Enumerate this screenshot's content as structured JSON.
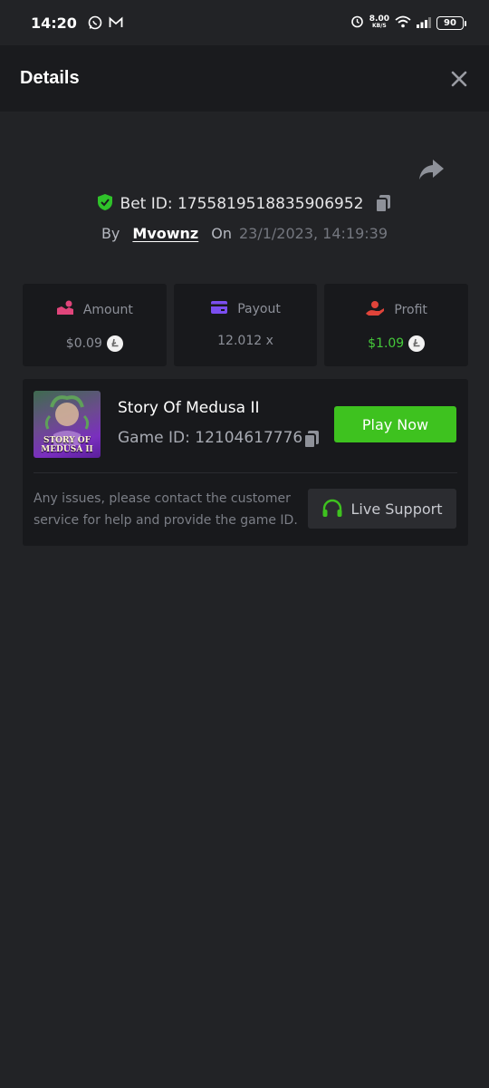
{
  "status_bar": {
    "time": "14:20",
    "speed_value": "8.00",
    "speed_unit": "KB/S",
    "battery": "90",
    "icons": [
      "whatsapp-icon",
      "gmail-icon",
      "alarm-icon",
      "wifi-icon",
      "signal-icon",
      "battery-icon"
    ]
  },
  "header": {
    "title": "Details",
    "close_icon": "close-icon"
  },
  "bet": {
    "id_label": "Bet ID: 1755819518835906952",
    "by_label": "By",
    "username": "Mvownz",
    "on_label": "On",
    "date": "23/1/2023, 14:19:39"
  },
  "stats": {
    "amount": {
      "label": "Amount",
      "value": "$0.09"
    },
    "payout": {
      "label": "Payout",
      "value": "12.012 x"
    },
    "profit": {
      "label": "Profit",
      "value": "$1.09"
    }
  },
  "game": {
    "name": "Story Of Medusa II",
    "game_id": "Game ID: 12104617776",
    "thumb_title_line1": "STORY OF",
    "thumb_title_line2": "MEDUSA II",
    "play_label": "Play Now"
  },
  "support": {
    "text": "Any issues, please contact the customer service for help and provide the game ID.",
    "button_label": "Live Support"
  },
  "colors": {
    "background": "#222326",
    "header": "#1a1b1e",
    "card": "#18191c",
    "accent_green": "#3ec21f",
    "profit_green": "#45c93a",
    "amount_pink": "#e0457b",
    "payout_purple": "#7b4ef0",
    "profit_red": "#e0443a"
  }
}
